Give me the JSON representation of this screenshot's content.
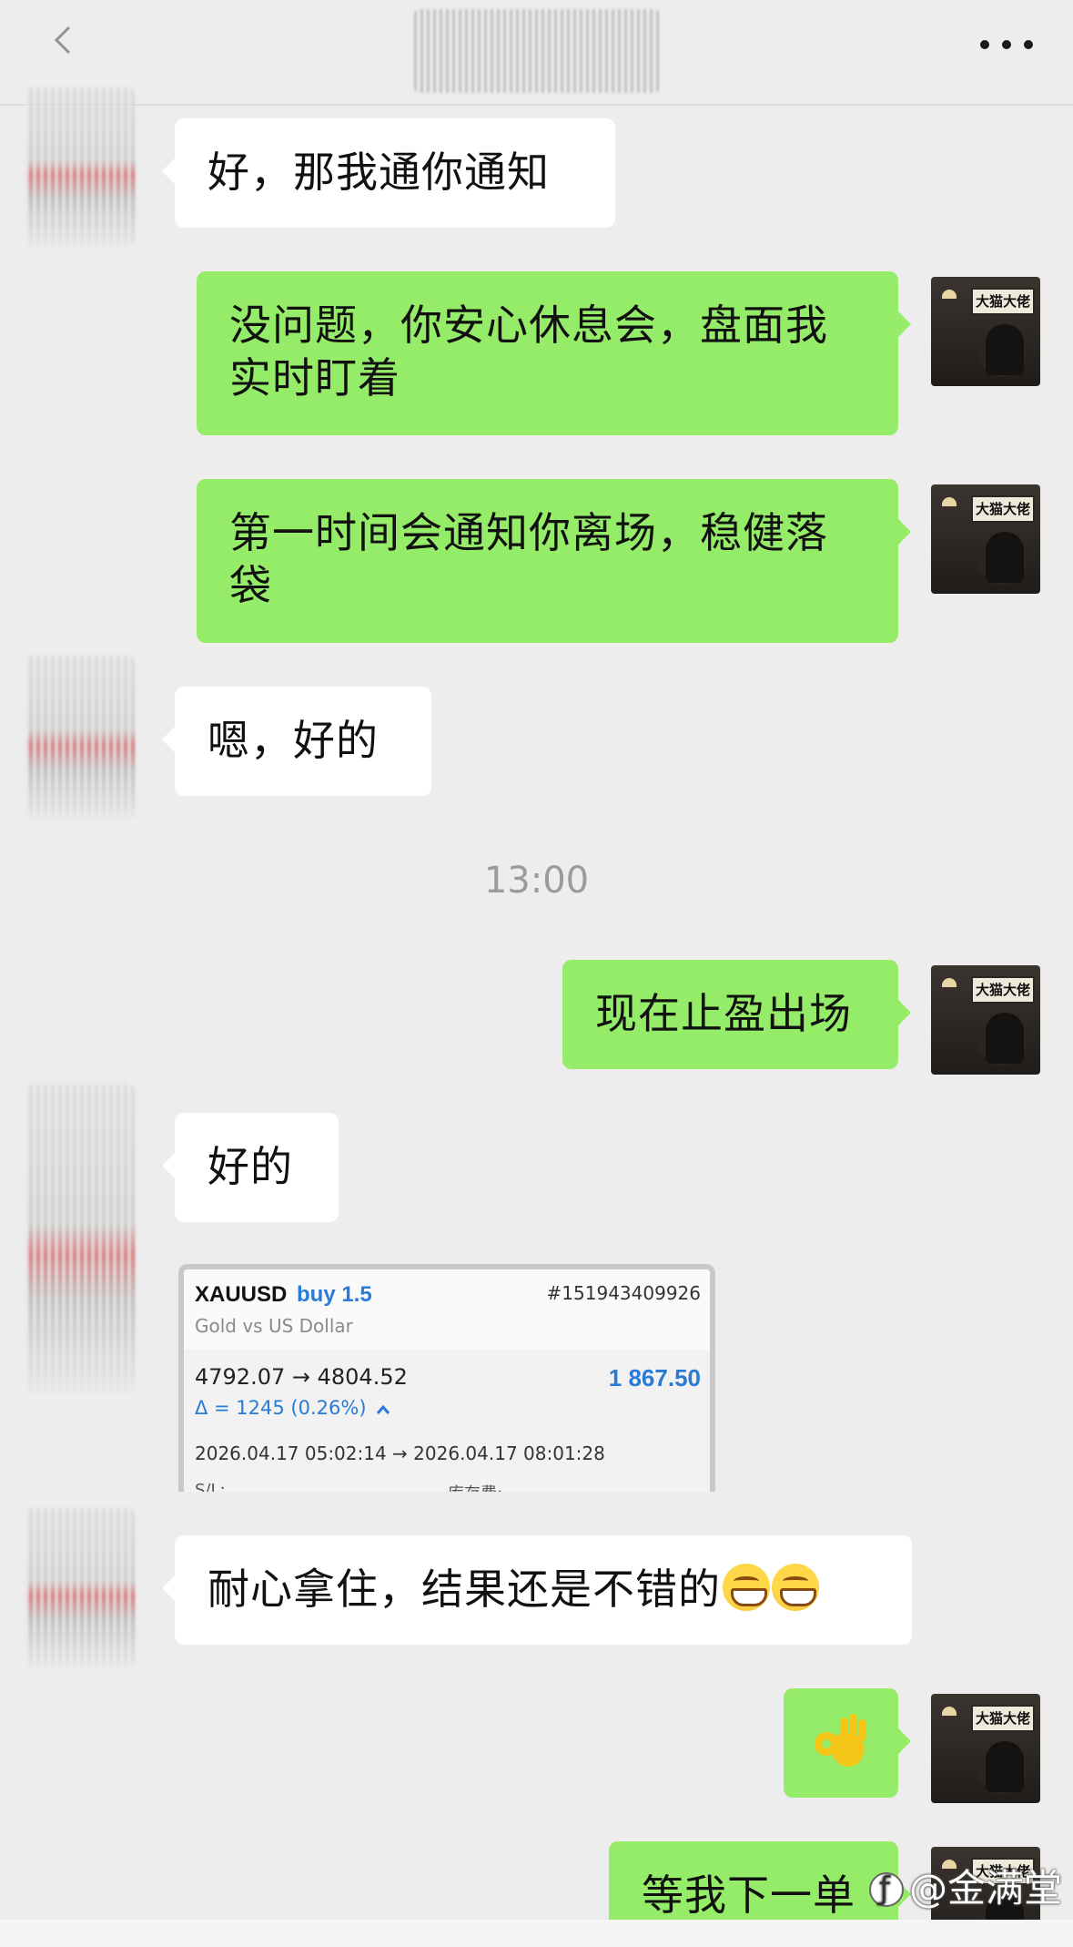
{
  "header": {
    "back_icon": "chevron-left-icon",
    "more_icon": "ellipsis-icon"
  },
  "messages": {
    "m1": "好，那我通你通知",
    "m2": "没问题，你安心休息会，盘面我实时盯着",
    "m3": "第一时间会通知你离场，稳健落袋",
    "m4": "嗯，好的",
    "timestamp": "13:00",
    "m5": "现在止盈出场",
    "m6": "好的",
    "m7": "耐心拿住，结果还是不错的",
    "m8_emoji": "ok-hand",
    "m9": "等我下一单"
  },
  "avatar_sign": "大猫大佬",
  "trade_card": {
    "symbol": "XAUUSD",
    "side": "buy 1.5",
    "ticket": "#151943409926",
    "description": "Gold vs US Dollar",
    "prices": "4792.07 → 4804.52",
    "profit": "1 867.50",
    "delta": "Δ = 1245 (0.26%)",
    "times": "2026.04.17 05:02:14 → 2026.04.17 08:01:28",
    "sl_label": "S/L:",
    "swap_label": "库存费:"
  },
  "watermark": "@金满堂",
  "colors": {
    "background": "#ededed",
    "my_bubble": "#95ec69",
    "their_bubble": "#ffffff",
    "profit_blue": "#2a7bd6"
  }
}
